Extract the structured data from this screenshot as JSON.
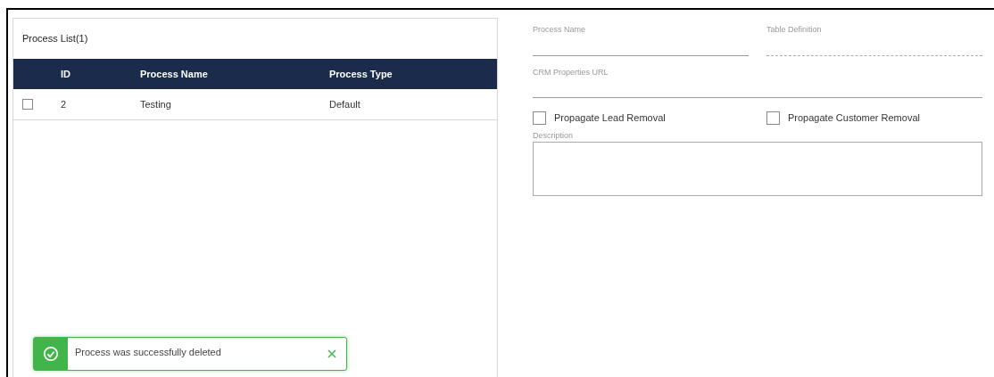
{
  "process_list": {
    "title": "Process List(1)",
    "columns": [
      "ID",
      "Process Name",
      "Process Type"
    ],
    "rows": [
      {
        "checked": false,
        "cells": [
          "2",
          "Testing",
          "Default"
        ]
      }
    ]
  },
  "form": {
    "process_name": {
      "label": "Process Name"
    },
    "table_definition": {
      "label": "Table Definition",
      "disabled": true
    },
    "crm_url": {
      "label": "CRM Properties URL"
    },
    "checkboxes": [
      {
        "label": "Propagate Lead Removal",
        "checked": false
      },
      {
        "label": "Propagate Customer Removal",
        "checked": false
      }
    ],
    "description": {
      "label": "Description"
    }
  },
  "toast": {
    "message": "Process was successfully deleted",
    "kind": "success"
  }
}
